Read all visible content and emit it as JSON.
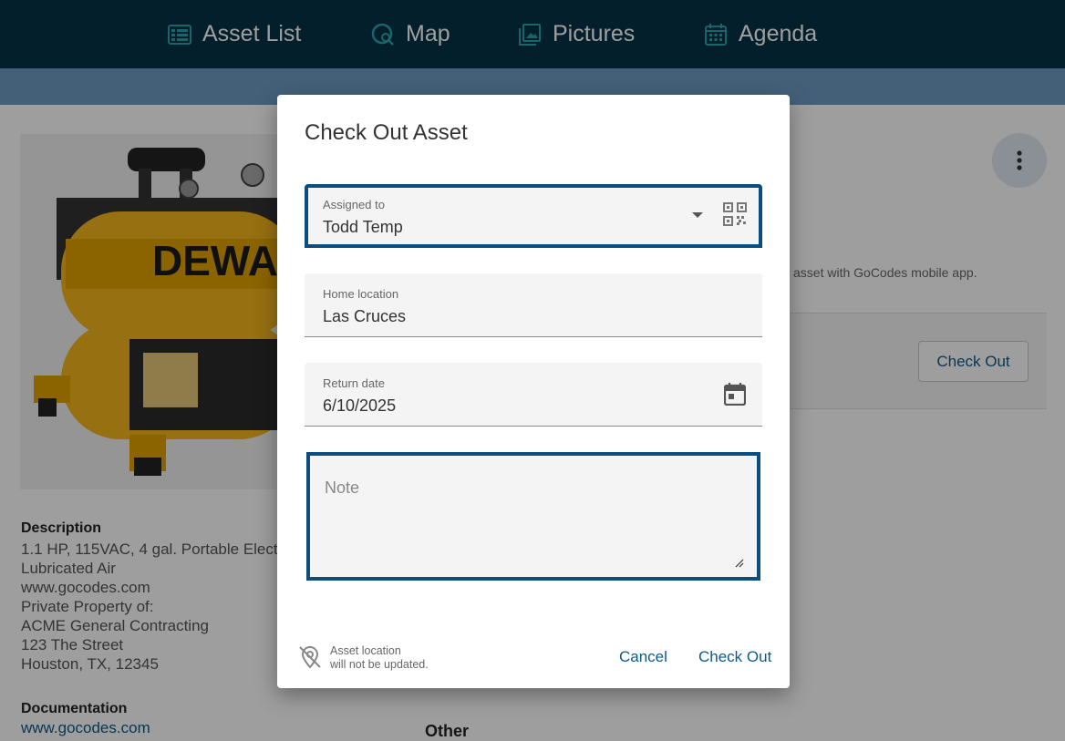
{
  "nav": {
    "items": [
      {
        "label": "Asset List",
        "icon": "list-icon"
      },
      {
        "label": "Map",
        "icon": "map-search-icon"
      },
      {
        "label": "Pictures",
        "icon": "pictures-icon"
      },
      {
        "label": "Agenda",
        "icon": "calendar-icon"
      }
    ]
  },
  "background": {
    "description_title": "Description",
    "description_lines": "1.1 HP, 115VAC, 4 gal. Portable Elect\nLubricated Air\nwww.gocodes.com\nPrivate Property of:\nACME General Contracting\n123 The Street\nHouston, TX, 12345",
    "documentation_title": "Documentation",
    "documentation_link": "www.gocodes.com",
    "other_title": "Other",
    "mobile_hint": "asset with GoCodes mobile app.",
    "checkout_button": "Check Out",
    "photo_brand_text": "DEWA"
  },
  "dialog": {
    "title": "Check Out Asset",
    "assigned_to": {
      "label": "Assigned to",
      "value": "Todd Temp"
    },
    "home_location": {
      "label": "Home location",
      "value": "Las Cruces"
    },
    "return_date": {
      "label": "Return date",
      "value": "6/10/2025"
    },
    "note": {
      "placeholder": "Note"
    },
    "location_notice": {
      "line1": "Asset location",
      "line2": "will not be updated."
    },
    "cancel_label": "Cancel",
    "checkout_label": "Check Out"
  },
  "colors": {
    "topbar": "#063247",
    "accent": "#0e5a86",
    "focus_outline": "#0c4d7f"
  }
}
